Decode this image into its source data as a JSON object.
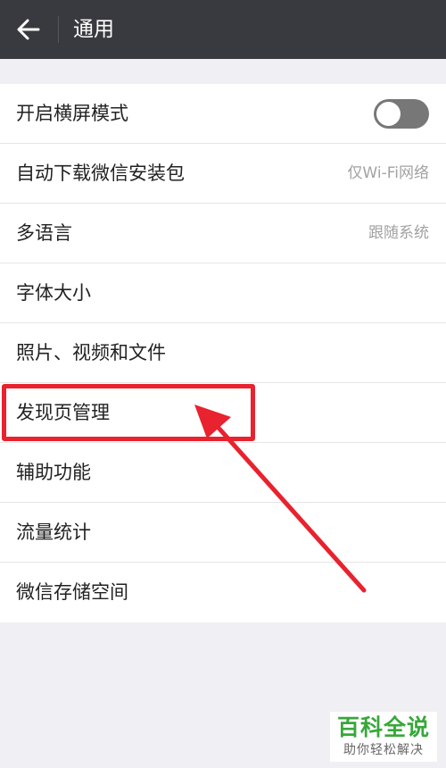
{
  "header": {
    "back_icon": "arrow-left-icon",
    "title": "通用"
  },
  "settings": {
    "landscape": {
      "label": "开启横屏模式",
      "toggle_on": false
    },
    "auto_download": {
      "label": "自动下载微信安装包",
      "value": "仅Wi-Fi网络"
    },
    "language": {
      "label": "多语言",
      "value": "跟随系统"
    },
    "font_size": {
      "label": "字体大小"
    },
    "media": {
      "label": "照片、视频和文件"
    },
    "discover": {
      "label": "发现页管理"
    },
    "accessibility": {
      "label": "辅助功能"
    },
    "traffic": {
      "label": "流量统计"
    },
    "storage": {
      "label": "微信存储空间"
    }
  },
  "annotation": {
    "color": "#e8222e"
  },
  "watermark": {
    "main": "百科全说",
    "sub": "助你轻松解决"
  },
  "colors": {
    "header_bg": "#393a3f",
    "page_bg": "#efeff4",
    "toggle_off": "#777777",
    "watermark_green": "#37a83a"
  }
}
